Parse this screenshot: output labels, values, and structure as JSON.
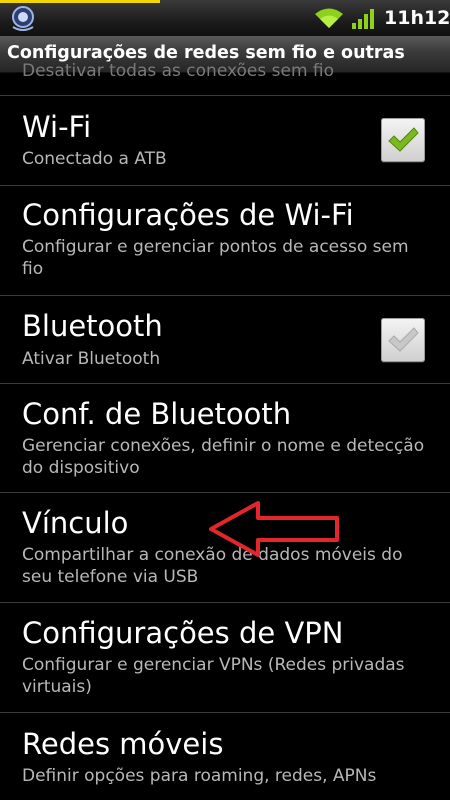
{
  "status_bar": {
    "time": "11h12",
    "icons": [
      "notification-icon",
      "wifi-icon",
      "signal-icon"
    ],
    "accent_color": "#f1d600"
  },
  "header": {
    "title": "Configurações de redes sem fio e outras"
  },
  "partial_item": {
    "summary": "Desativar todas as conexões sem fio"
  },
  "items": [
    {
      "title": "Wi-Fi",
      "summary": "Conectado a ATB",
      "checkbox": "checked"
    },
    {
      "title": "Configurações de Wi-Fi",
      "summary": "Configurar e gerenciar pontos de acesso sem fio"
    },
    {
      "title": "Bluetooth",
      "summary": "Ativar Bluetooth",
      "checkbox": "disabled-checked"
    },
    {
      "title": "Conf. de Bluetooth",
      "summary": "Gerenciar conexões, definir o nome e detecção do dispositivo"
    },
    {
      "title": "Vínculo",
      "summary": "Compartilhar a conexão de dados móveis do seu telefone via USB"
    },
    {
      "title": "Configurações de VPN",
      "summary": "Configurar e gerenciar VPNs (Redes privadas virtuais)"
    },
    {
      "title": "Redes móveis",
      "summary": "Definir opções para roaming, redes, APNs"
    }
  ],
  "colors": {
    "check_green": "#7cb81f",
    "check_disabled": "#c8c8c8",
    "arrow_red": "#e3262b",
    "divider": "#3b3b3b"
  },
  "annotation": {
    "arrow_icon": "red-arrow-left-icon",
    "points_to": "Vínculo"
  }
}
